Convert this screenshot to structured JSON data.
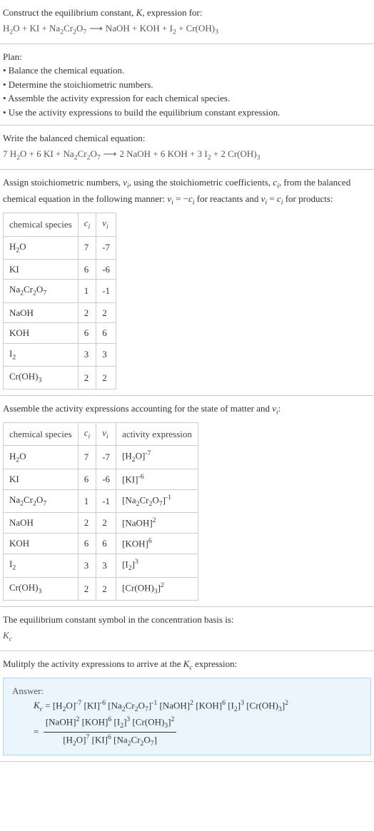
{
  "chart_data": {
    "type": "table",
    "tables": [
      {
        "columns": [
          "chemical species",
          "c_i",
          "ν_i"
        ],
        "rows": [
          [
            "H2O",
            "7",
            "-7"
          ],
          [
            "KI",
            "6",
            "-6"
          ],
          [
            "Na2Cr2O7",
            "1",
            "-1"
          ],
          [
            "NaOH",
            "2",
            "2"
          ],
          [
            "KOH",
            "6",
            "6"
          ],
          [
            "I2",
            "3",
            "3"
          ],
          [
            "Cr(OH)3",
            "2",
            "2"
          ]
        ]
      },
      {
        "columns": [
          "chemical species",
          "c_i",
          "ν_i",
          "activity expression"
        ],
        "rows": [
          [
            "H2O",
            "7",
            "-7",
            "[H2O]^-7"
          ],
          [
            "KI",
            "6",
            "-6",
            "[KI]^-6"
          ],
          [
            "Na2Cr2O7",
            "1",
            "-1",
            "[Na2Cr2O7]^-1"
          ],
          [
            "NaOH",
            "2",
            "2",
            "[NaOH]^2"
          ],
          [
            "KOH",
            "6",
            "6",
            "[KOH]^6"
          ],
          [
            "I2",
            "3",
            "3",
            "[I2]^3"
          ],
          [
            "Cr(OH)3",
            "2",
            "2",
            "[Cr(OH)3]^2"
          ]
        ]
      }
    ]
  },
  "header": {
    "line1": "Construct the equilibrium constant, ",
    "Kital": "K",
    "line1b": ", expression for:"
  },
  "plan": {
    "title": "Plan:",
    "b1": "• Balance the chemical equation.",
    "b2": "• Determine the stoichiometric numbers.",
    "b3": "• Assemble the activity expression for each chemical species.",
    "b4": "• Use the activity expressions to build the equilibrium constant expression."
  },
  "balanced": {
    "title": "Write the balanced chemical equation:"
  },
  "assign": {
    "pre": "Assign stoichiometric numbers, ",
    "midA": ", using the stoichiometric coefficients, ",
    "midB": ", from the balanced chemical equation in the following manner: ",
    "forReact": " for reactants and ",
    "forProd": " for products:"
  },
  "activity": {
    "pre": "Assemble the activity expressions accounting for the state of matter and "
  },
  "symbolSection": {
    "text": "The equilibrium constant symbol in the concentration basis is:"
  },
  "multiply": {
    "pre": "Mulitply the activity expressions to arrive at the ",
    "post": " expression:"
  },
  "answer": {
    "label": "Answer:"
  },
  "t1": {
    "h1": "chemical species",
    "h2": "",
    "h3": "",
    "r1c1": "H",
    "r1c2": "7",
    "r1c3": "-7",
    "r2c1": "KI",
    "r2c2": "6",
    "r2c3": "-6",
    "r3c1": "Na",
    "r3c2": "1",
    "r3c3": "-1",
    "r4c1": "NaOH",
    "r4c2": "2",
    "r4c3": "2",
    "r5c1": "KOH",
    "r5c2": "6",
    "r5c3": "6",
    "r6c1": "I",
    "r6c2": "3",
    "r6c3": "3",
    "r7c1": "Cr(OH)",
    "r7c2": "2",
    "r7c3": "2"
  },
  "t2": {
    "r1c2": "7",
    "r1c3": "-7",
    "r2c2": "6",
    "r2c3": "-6",
    "r3c2": "1",
    "r3c3": "-1",
    "r4c2": "2",
    "r4c3": "2",
    "r5c2": "6",
    "r5c3": "6",
    "r6c2": "3",
    "r6c3": "3",
    "r7c2": "2",
    "r7c3": "2"
  }
}
